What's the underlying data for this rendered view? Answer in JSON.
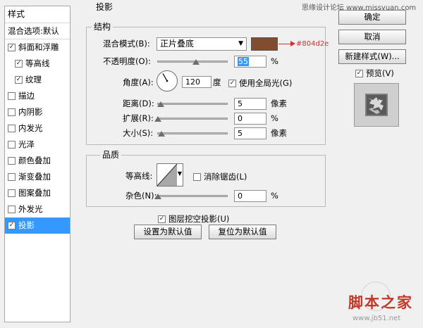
{
  "header": {
    "section_title": "投影",
    "watermark_top": "思缘设计论坛 www.missyuan.com"
  },
  "styles_panel": {
    "title": "样式",
    "blend_options": "混合选项:默认",
    "items": [
      {
        "label": "斜面和浮雕",
        "checked": true,
        "sub": false,
        "selected": false
      },
      {
        "label": "等高线",
        "checked": true,
        "sub": true,
        "selected": false
      },
      {
        "label": "纹理",
        "checked": true,
        "sub": true,
        "selected": false
      },
      {
        "label": "描边",
        "checked": false,
        "sub": false,
        "selected": false
      },
      {
        "label": "内阴影",
        "checked": false,
        "sub": false,
        "selected": false
      },
      {
        "label": "内发光",
        "checked": false,
        "sub": false,
        "selected": false
      },
      {
        "label": "光泽",
        "checked": false,
        "sub": false,
        "selected": false
      },
      {
        "label": "颜色叠加",
        "checked": false,
        "sub": false,
        "selected": false
      },
      {
        "label": "渐变叠加",
        "checked": false,
        "sub": false,
        "selected": false
      },
      {
        "label": "图案叠加",
        "checked": false,
        "sub": false,
        "selected": false
      },
      {
        "label": "外发光",
        "checked": false,
        "sub": false,
        "selected": false
      },
      {
        "label": "投影",
        "checked": true,
        "sub": false,
        "selected": true
      }
    ]
  },
  "structure": {
    "title": "结构",
    "blend_mode_label": "混合模式(B):",
    "blend_mode_value": "正片叠底",
    "color_swatch": "#804d2e",
    "color_annotation": "#804d2e",
    "opacity_label": "不透明度(O):",
    "opacity_value": "55",
    "opacity_level": 55,
    "opacity_unit": "%",
    "angle_label": "角度(A):",
    "angle_value": "120",
    "angle_unit": "度",
    "global_light_label": "使用全局光(G)",
    "global_light_checked": true,
    "distance_label": "距离(D):",
    "distance_value": "5",
    "distance_unit": "像素",
    "spread_label": "扩展(R):",
    "spread_value": "0",
    "spread_unit": "%",
    "size_label": "大小(S):",
    "size_value": "5",
    "size_unit": "像素"
  },
  "quality": {
    "title": "品质",
    "contour_label": "等高线:",
    "anti_alias_label": "消除锯齿(L)",
    "anti_alias_checked": false,
    "noise_label": "杂色(N):",
    "noise_value": "0",
    "noise_unit": "%"
  },
  "knockout": {
    "label": "图层挖空投影(U)",
    "checked": true
  },
  "bottom_buttons": {
    "make_default": "设置为默认值",
    "reset_default": "复位为默认值"
  },
  "right_buttons": {
    "ok": "确定",
    "cancel": "取消",
    "new_style": "新建样式(W)...",
    "preview_label": "预览(V)",
    "preview_checked": true
  },
  "watermark": {
    "logo_text": "脚本之家",
    "url": "www.jb51.net"
  }
}
